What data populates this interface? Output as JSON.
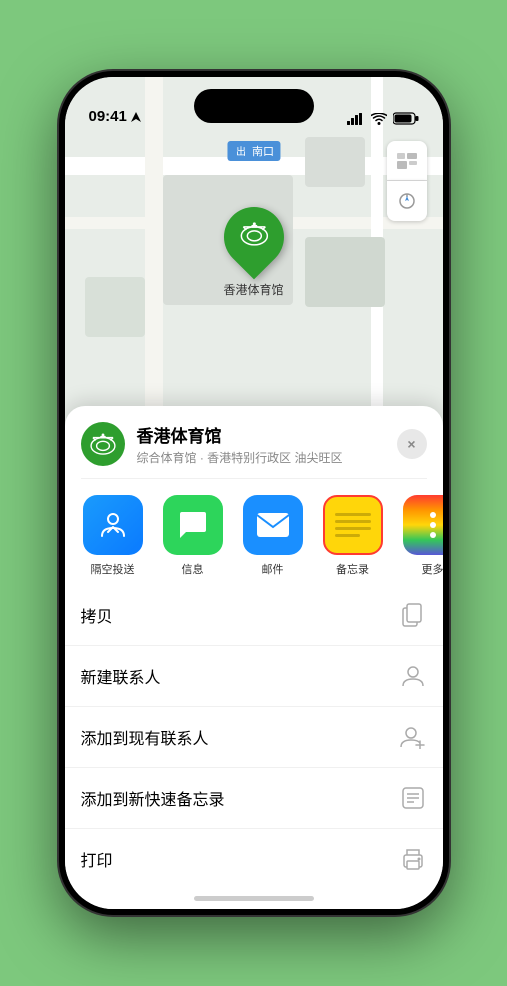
{
  "status": {
    "time": "09:41",
    "location_arrow": "▲"
  },
  "map": {
    "label": "南口",
    "label_prefix": "出"
  },
  "pin": {
    "label": "香港体育馆"
  },
  "venue": {
    "name": "香港体育馆",
    "sub": "综合体育馆 · 香港特别行政区 油尖旺区",
    "close_label": "×"
  },
  "share_items": [
    {
      "id": "airdrop",
      "label": "隔空投送",
      "type": "airdrop"
    },
    {
      "id": "messages",
      "label": "信息",
      "type": "messages"
    },
    {
      "id": "mail",
      "label": "邮件",
      "type": "mail"
    },
    {
      "id": "notes",
      "label": "备忘录",
      "type": "notes"
    },
    {
      "id": "more",
      "label": "更多",
      "type": "more"
    }
  ],
  "actions": [
    {
      "label": "拷贝",
      "icon": "copy"
    },
    {
      "label": "新建联系人",
      "icon": "person"
    },
    {
      "label": "添加到现有联系人",
      "icon": "person-add"
    },
    {
      "label": "添加到新快速备忘录",
      "icon": "note"
    },
    {
      "label": "打印",
      "icon": "print"
    }
  ]
}
